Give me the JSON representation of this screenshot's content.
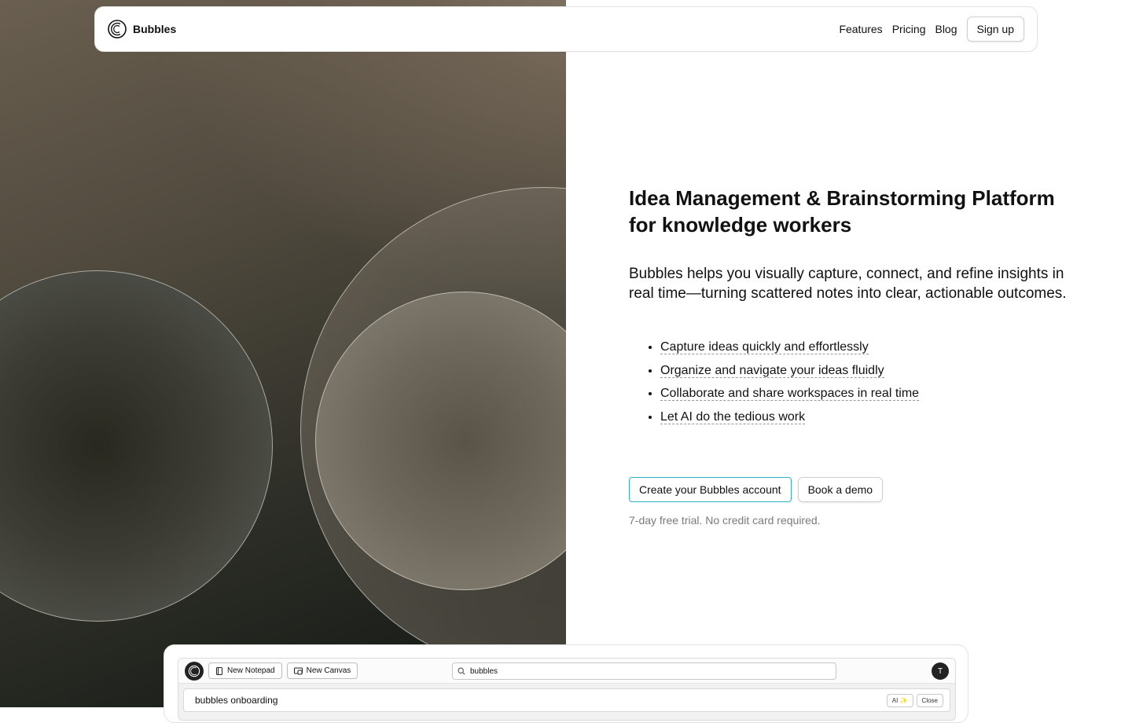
{
  "nav": {
    "brand": "Bubbles",
    "links": [
      "Features",
      "Pricing",
      "Blog"
    ],
    "signup_label": "Sign up"
  },
  "hero": {
    "title": "Idea Management & Brainstorming Platform for knowledge workers",
    "subtitle": "Bubbles helps you visually capture, connect, and refine insights in real time—turning scattered notes into clear, actionable outcomes.",
    "features": [
      "Capture ideas quickly and effortlessly",
      "Organize and navigate your ideas fluidly",
      "Collaborate and share workspaces in real time",
      "Let AI do the tedious work"
    ],
    "cta_primary": "Create your Bubbles account",
    "cta_secondary": "Book a demo",
    "trial_note": "7-day free trial. No credit card required."
  },
  "app_preview": {
    "new_notepad_label": "New Notepad",
    "new_canvas_label": "New Canvas",
    "search_value": "bubbles",
    "avatar_initial": "T",
    "notepad_title": "bubbles onboarding",
    "ai_label": "AI ✨",
    "close_label": "Close"
  },
  "icons": {
    "logo": "bubbles-logo-icon",
    "notepad": "notepad-icon",
    "canvas": "canvas-icon",
    "search": "search-icon"
  },
  "colors": {
    "cta_border": "#2bb3c0",
    "muted_text": "#7a7a7a"
  }
}
